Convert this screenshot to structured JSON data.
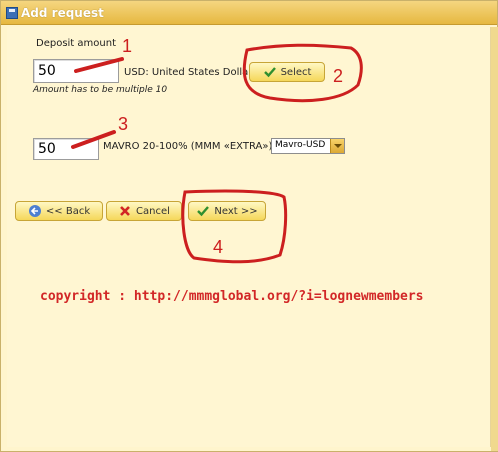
{
  "window": {
    "title": "Add request"
  },
  "form": {
    "deposit_label": "Deposit amount",
    "amount_value": "50",
    "currency_text": "USD: United States Dolla",
    "select_label": "Select",
    "hint": "Amount has to be multiple 10",
    "mavro_value": "50",
    "mavro_text": "MAVRO 20-100% (MMM «EXTRA»)",
    "mavro_currency": "Mavro-USD"
  },
  "buttons": {
    "back": "<< Back",
    "cancel": "Cancel",
    "next": "Next >>"
  },
  "annotations": {
    "n1": "1",
    "n2": "2",
    "n3": "3",
    "n4": "4",
    "copyright": "copyright : http://mmmglobal.org/?i=lognewmembers"
  },
  "icons": {
    "window": "window-icon",
    "select": "check-icon",
    "back": "back-arrow-icon",
    "cancel": "cancel-x-icon",
    "next": "check-icon"
  },
  "colors": {
    "background": "#fff6d2",
    "titlebar": "#e6b840",
    "accent_red": "#d22727",
    "button": "#f5d75a"
  }
}
